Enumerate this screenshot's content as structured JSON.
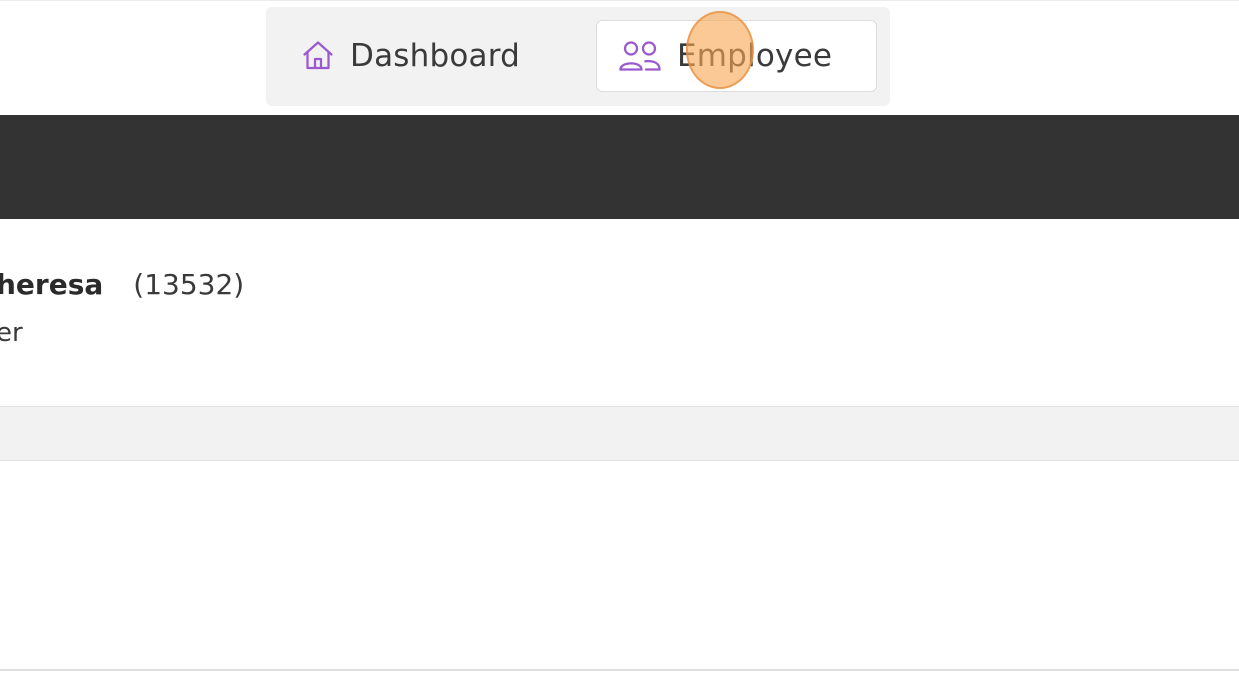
{
  "nav": {
    "tabs": [
      {
        "label": "Dashboard",
        "icon": "home-icon",
        "active": false
      },
      {
        "label": "Employee",
        "icon": "users-icon",
        "active": true
      }
    ]
  },
  "employee": {
    "name": "heresa",
    "id": "(13532)",
    "role": "er"
  },
  "colors": {
    "icon_accent": "#9b59d0",
    "header_band": "#333333",
    "click_marker": "#f8a856"
  }
}
